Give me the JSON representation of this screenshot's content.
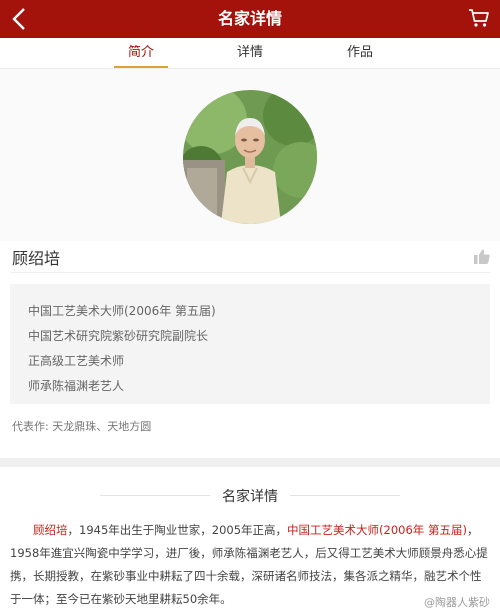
{
  "header": {
    "title": "名家详情",
    "back_icon": "chevron-left-icon",
    "cart_icon": "cart-icon"
  },
  "tabs": [
    {
      "label": "简介",
      "active": true
    },
    {
      "label": "详情",
      "active": false
    },
    {
      "label": "作品",
      "active": false
    }
  ],
  "artist": {
    "name": "顾绍培",
    "titles": [
      "中国工艺美术大师(2006年 第五届)",
      "中国艺术研究院紫砂研究院副院长",
      "正高级工艺美术师",
      "师承陈福渊老艺人"
    ],
    "representative_works": "代表作: 天龙鼎珠、天地方圆"
  },
  "section": {
    "title": "名家详情"
  },
  "bio": {
    "name": "顾绍培",
    "part1": "，1945年出生于陶业世家，2005年正高，",
    "highlight": "中国工艺美术大师(2006年 第五届)",
    "part2": "，1958年進宜兴陶瓷中学学习，进厂後，师承陈福渊老艺人，后又得工艺美术大师顾景舟悉心提携，长期授教，在紫砂事业中耕耘了四十余载，深研诸名师技法，集各派之精华，融艺术个性于一体；至今已在紫砂天地里耕耘50余年。"
  },
  "watermark": "@陶器人紫砂",
  "colors": {
    "header_red": "#a3120b",
    "accent_gold": "#d9a23a",
    "text_red": "#c8221b"
  }
}
